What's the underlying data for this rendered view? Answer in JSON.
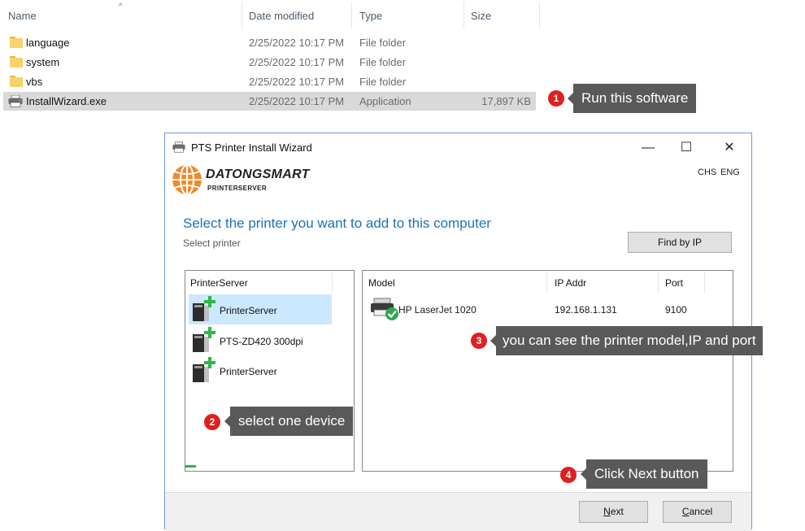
{
  "explorer": {
    "columns": {
      "name": "Name",
      "date": "Date modified",
      "type": "Type",
      "size": "Size"
    },
    "rows": [
      {
        "name": "language",
        "date": "2/25/2022 10:17 PM",
        "type": "File folder",
        "size": "",
        "icon": "folder-icon"
      },
      {
        "name": "system",
        "date": "2/25/2022 10:17 PM",
        "type": "File folder",
        "size": "",
        "icon": "folder-icon"
      },
      {
        "name": "vbs",
        "date": "2/25/2022 10:17 PM",
        "type": "File folder",
        "size": "",
        "icon": "folder-icon"
      },
      {
        "name": "InstallWizard.exe",
        "date": "2/25/2022 10:17 PM",
        "type": "Application",
        "size": "17,897 KB",
        "icon": "printer-icon"
      }
    ]
  },
  "callouts": [
    {
      "num": "1",
      "text": "Run this software"
    },
    {
      "num": "2",
      "text": "select one device"
    },
    {
      "num": "3",
      "text": "you can see the printer model,IP and port"
    },
    {
      "num": "4",
      "text": "Click Next button"
    }
  ],
  "dialog": {
    "title": "PTS Printer Install Wizard",
    "controls": {
      "minimize": "—",
      "maximize": "☐",
      "close": "✕"
    },
    "brand": "DATONGSMART",
    "brand_sub": "PRINTERSERVER",
    "lang": {
      "chs": "CHS",
      "eng": "ENG"
    },
    "heading": "Select the printer you want to add to this computer",
    "subheading": "Select printer",
    "find_by_ip": "Find by IP",
    "left_panel": {
      "header": "PrinterServer",
      "devices": [
        {
          "label": "PrinterServer",
          "selected": true
        },
        {
          "label": "PTS-ZD420 300dpi",
          "selected": false
        },
        {
          "label": "PrinterServer",
          "selected": false
        }
      ]
    },
    "right_panel": {
      "headers": {
        "model": "Model",
        "ip": "IP Addr",
        "port": "Port"
      },
      "rows": [
        {
          "model": "HP LaserJet 1020",
          "ip": "192.168.1.131",
          "port": "9100"
        }
      ]
    },
    "buttons": {
      "next_first": "N",
      "next_rest": "ext",
      "cancel_first": "C",
      "cancel_rest": "ancel"
    }
  },
  "colors": {
    "accent_blue": "#1e72b8",
    "callout_bg": "#595959",
    "badge_red": "#e02020",
    "selection": "#cce8ff"
  }
}
